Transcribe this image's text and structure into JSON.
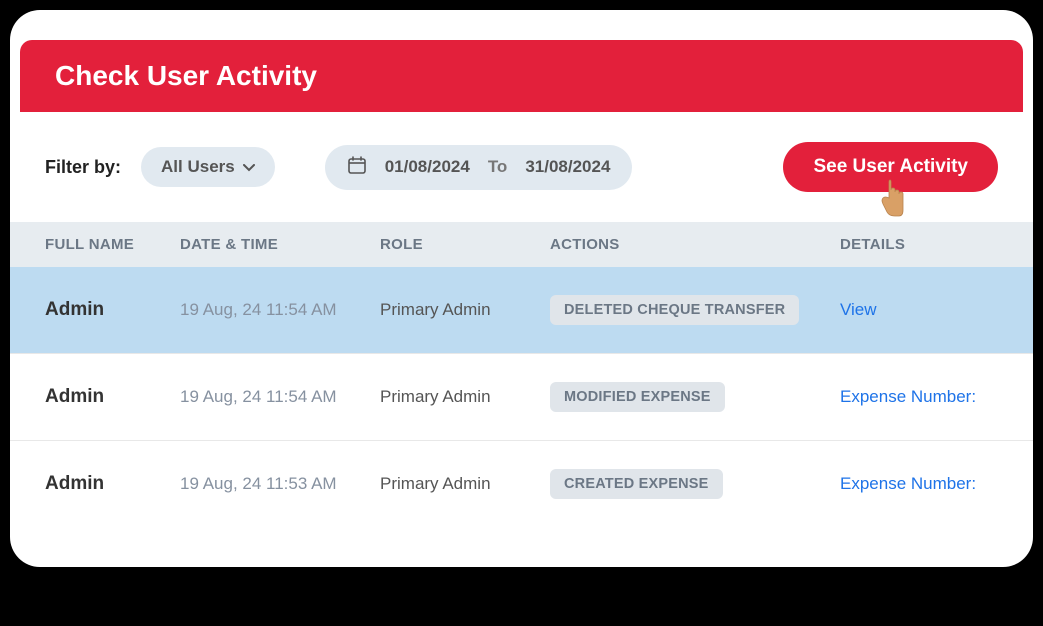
{
  "header": {
    "title": "Check User Activity"
  },
  "filter": {
    "label": "Filter by:",
    "selected": "All Users",
    "from_date": "01/08/2024",
    "range_lbl": "To",
    "to_date": "31/08/2024"
  },
  "cta_label": "See User Activity",
  "columns": {
    "name": "FULL NAME",
    "datetime": "DATE & TIME",
    "role": "ROLE",
    "actions": "ACTIONS",
    "details": "DETAILS"
  },
  "rows": [
    {
      "name": "Admin",
      "dt": "19 Aug, 24 11:54 AM",
      "role": "Primary Admin",
      "action": "DELETED CHEQUE TRANSFER",
      "detail": "View",
      "hl": true
    },
    {
      "name": "Admin",
      "dt": "19 Aug, 24 11:54 AM",
      "role": "Primary Admin",
      "action": "MODIFIED EXPENSE",
      "detail": "Expense Number:",
      "hl": false
    },
    {
      "name": "Admin",
      "dt": "19 Aug, 24 11:53 AM",
      "role": "Primary Admin",
      "action": "CREATED EXPENSE",
      "detail": "Expense Number:",
      "hl": false
    }
  ]
}
